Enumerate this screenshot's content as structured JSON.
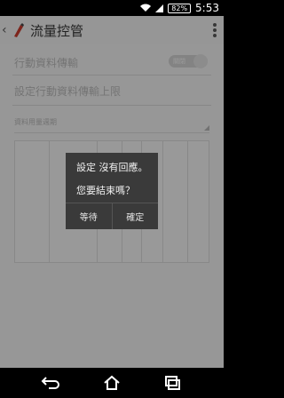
{
  "status_bar": {
    "battery": "82%",
    "time": "5:53"
  },
  "app_bar": {
    "title": "流量控管"
  },
  "settings": {
    "mobile_data_label": "行動資料傳輸",
    "mobile_data_toggle": "關閉",
    "limit_label": "設定行動資料傳輸上限",
    "usage_cycle_label": "資料用量週期"
  },
  "dialog": {
    "title": "設定 沒有回應。",
    "message": "您要結束嗎？",
    "wait_button": "等待",
    "ok_button": "確定"
  },
  "icons": {
    "back": "back-arrow-icon",
    "overflow": "overflow-menu-icon",
    "nav_back": "nav-back-icon",
    "nav_home": "nav-home-icon",
    "nav_recents": "nav-recents-icon"
  }
}
